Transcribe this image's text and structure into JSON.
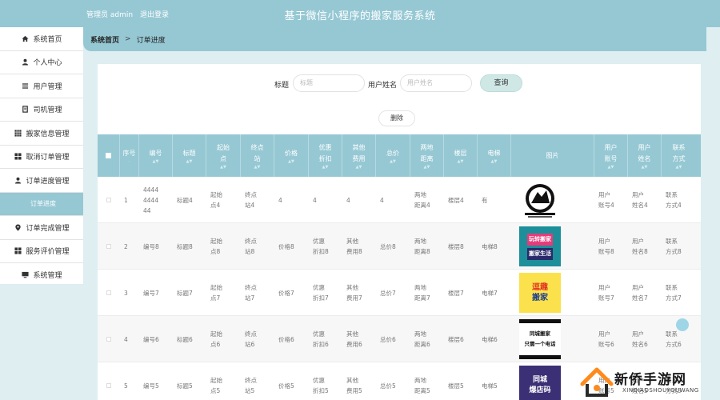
{
  "header": {
    "user_role": "管理员 admin",
    "logout": "退出登录",
    "title": "基于微信小程序的搬家服务系统"
  },
  "sidebar": {
    "items": [
      {
        "label": "系统首页",
        "icon": "home-icon"
      },
      {
        "label": "个人中心",
        "icon": "person-icon"
      },
      {
        "label": "用户管理",
        "icon": "list-icon"
      },
      {
        "label": "司机管理",
        "icon": "doc-icon"
      },
      {
        "label": "搬家信息管理",
        "icon": "grid-icon"
      },
      {
        "label": "取消订单管理",
        "icon": "grid4-icon"
      },
      {
        "label": "订单进度管理",
        "icon": "person-icon"
      },
      {
        "label": "订单进度",
        "icon": "",
        "sub": true
      },
      {
        "label": "订单完成管理",
        "icon": "pin-icon"
      },
      {
        "label": "服务评价管理",
        "icon": "grid4-icon"
      },
      {
        "label": "系统管理",
        "icon": "monitor-icon"
      }
    ]
  },
  "breadcrumb": {
    "home": "系统首页",
    "separator": ">",
    "current": "订单进度"
  },
  "search": {
    "title_label": "标题",
    "title_placeholder": "标题",
    "username_label": "用户姓名",
    "username_placeholder": "用户姓名",
    "search_button": "查询",
    "delete_button": "删除"
  },
  "table": {
    "columns": [
      "",
      "序号",
      "编号",
      "标题",
      "起始点",
      "终点站",
      "价格",
      "优惠折扣",
      "其他费用",
      "总价",
      "两地距离",
      "楼层",
      "电梯",
      "图片",
      "用户账号",
      "用户姓名",
      "联系方式"
    ],
    "rows": [
      {
        "index": "1",
        "code": "4444444444",
        "title": "标题4",
        "start": "起始点4",
        "end": "终点站4",
        "price": "4",
        "discount": "4",
        "other": "4",
        "total": "4",
        "distance": "两地距离4",
        "floor": "楼层4",
        "elevator": "有",
        "image": "moving-logo",
        "account": "用户账号4",
        "name": "用户姓名4",
        "contact": "联系方式4"
      },
      {
        "index": "2",
        "code": "编号8",
        "title": "标题8",
        "start": "起始点8",
        "end": "终点站8",
        "price": "价格8",
        "discount": "优惠折扣8",
        "other": "其他费用8",
        "total": "总价8",
        "distance": "两地距离8",
        "floor": "楼层8",
        "elevator": "电梯8",
        "image": "poster-2",
        "account": "用户账号8",
        "name": "用户姓名8",
        "contact": "联系方式8"
      },
      {
        "index": "3",
        "code": "编号7",
        "title": "标题7",
        "start": "起始点7",
        "end": "终点站7",
        "price": "价格7",
        "discount": "优惠折扣7",
        "other": "其他费用7",
        "total": "总价7",
        "distance": "两地距离7",
        "floor": "楼层7",
        "elevator": "电梯7",
        "image": "poster-3",
        "account": "用户账号7",
        "name": "用户姓名7",
        "contact": "联系方式7"
      },
      {
        "index": "4",
        "code": "编号6",
        "title": "标题6",
        "start": "起始点6",
        "end": "终点站6",
        "price": "价格6",
        "discount": "优惠折扣6",
        "other": "其他费用6",
        "total": "总价6",
        "distance": "两地距离6",
        "floor": "楼层6",
        "elevator": "电梯6",
        "image": "poster-4",
        "account": "用户账号6",
        "name": "用户姓名6",
        "contact": "联系方式6"
      },
      {
        "index": "5",
        "code": "编号5",
        "title": "标题5",
        "start": "起始点5",
        "end": "终点站5",
        "price": "价格5",
        "discount": "优惠折扣5",
        "other": "其他费用5",
        "total": "总价5",
        "distance": "两地距离5",
        "floor": "楼层5",
        "elevator": "电梯5",
        "image": "poster-5",
        "account": "用户账号5",
        "name": "用户姓名5",
        "contact": "联系方式5"
      }
    ],
    "thumb_text": {
      "poster2": [
        "玩转搬家",
        "搬家生活"
      ],
      "poster3": [
        "逗趣",
        "搬家"
      ],
      "poster4": [
        "同城搬家",
        "只需一个电话"
      ],
      "poster5": [
        "同城",
        "爆店码"
      ]
    }
  },
  "watermark": {
    "title": "新侨手游网",
    "sub": "XINQIAOSHOUYOUWANG"
  },
  "colors": {
    "accent": "#96c8d4",
    "background": "#dfeef0"
  }
}
